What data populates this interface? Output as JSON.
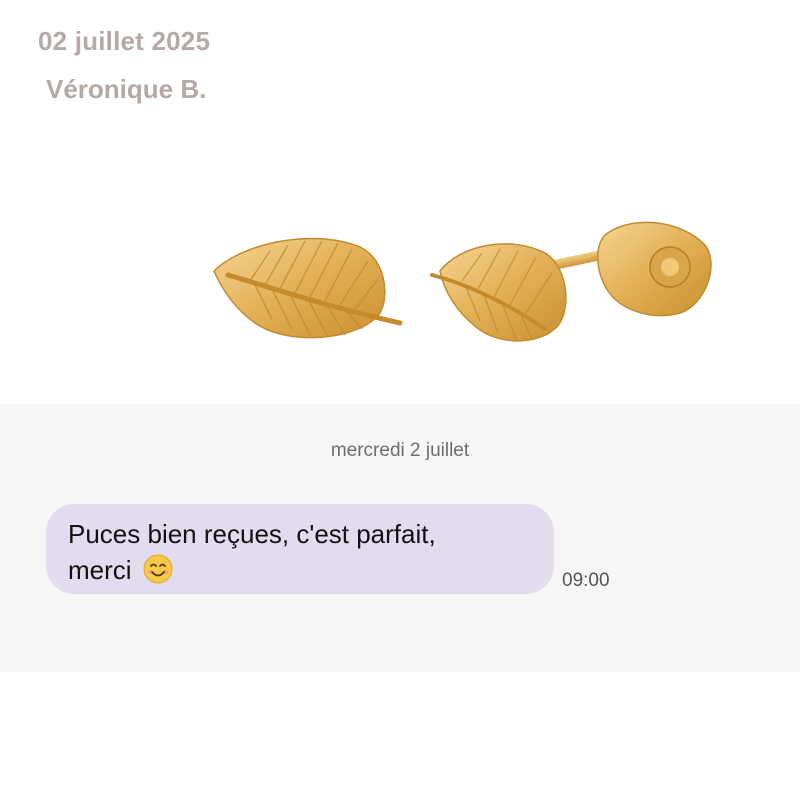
{
  "header": {
    "date": "02 juillet 2025",
    "author": "Véronique B."
  },
  "chat": {
    "day_separator": "mercredi 2 juillet",
    "message": {
      "text_line1": "Puces bien reçues, c'est parfait,",
      "text_line2": "merci",
      "emoji": "smiling-face-icon",
      "time": "09:00"
    }
  },
  "colors": {
    "header_text": "#b5a9a6",
    "bubble": "#e3dcef",
    "chat_background": "#f7f7f7",
    "gold": "#e2b055"
  }
}
